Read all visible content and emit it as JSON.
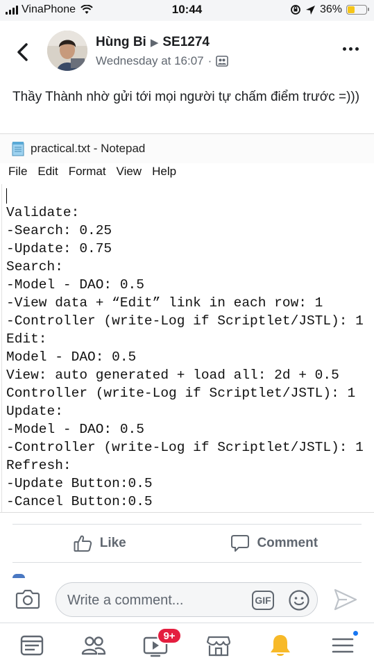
{
  "status_bar": {
    "carrier": "VinaPhone",
    "time": "10:44",
    "battery_pct": "36%",
    "battery_level": 0.36
  },
  "post": {
    "author": "Hùng Bi",
    "group": "SE1274",
    "timestamp": "Wednesday at 16:07",
    "separator": "·",
    "text": "Thầy Thành nhờ gửi tới mọi người tự chấm điểm trước =)))"
  },
  "notepad": {
    "title": "practical.txt - Notepad",
    "menu": [
      "File",
      "Edit",
      "Format",
      "View",
      "Help"
    ],
    "lines": [
      "Validate:",
      "-Search: 0.25",
      "-Update: 0.75",
      "Search:",
      "-Model - DAO: 0.5",
      "-View data + “Edit” link in each row: 1",
      "-Controller (write-Log if Scriptlet/JSTL): 1",
      "Edit:",
      "Model - DAO: 0.5",
      "View: auto generated + load all: 2d + 0.5",
      "Controller (write-Log if Scriptlet/JSTL): 1",
      "Update:",
      "-Model - DAO: 0.5",
      "-Controller (write-Log if Scriptlet/JSTL): 1",
      "Refresh:",
      "-Update Button:0.5",
      "-Cancel Button:0.5"
    ]
  },
  "actions": {
    "like_label": "Like",
    "comment_label": "Comment"
  },
  "composer": {
    "placeholder": "Write a comment...",
    "gif_label": "GIF"
  },
  "tabbar": {
    "watch_badge": "9+"
  },
  "colors": {
    "accent": "#1877f2",
    "badge": "#e41e3f",
    "secondary_text": "#606770",
    "bell": "#f7b928"
  }
}
